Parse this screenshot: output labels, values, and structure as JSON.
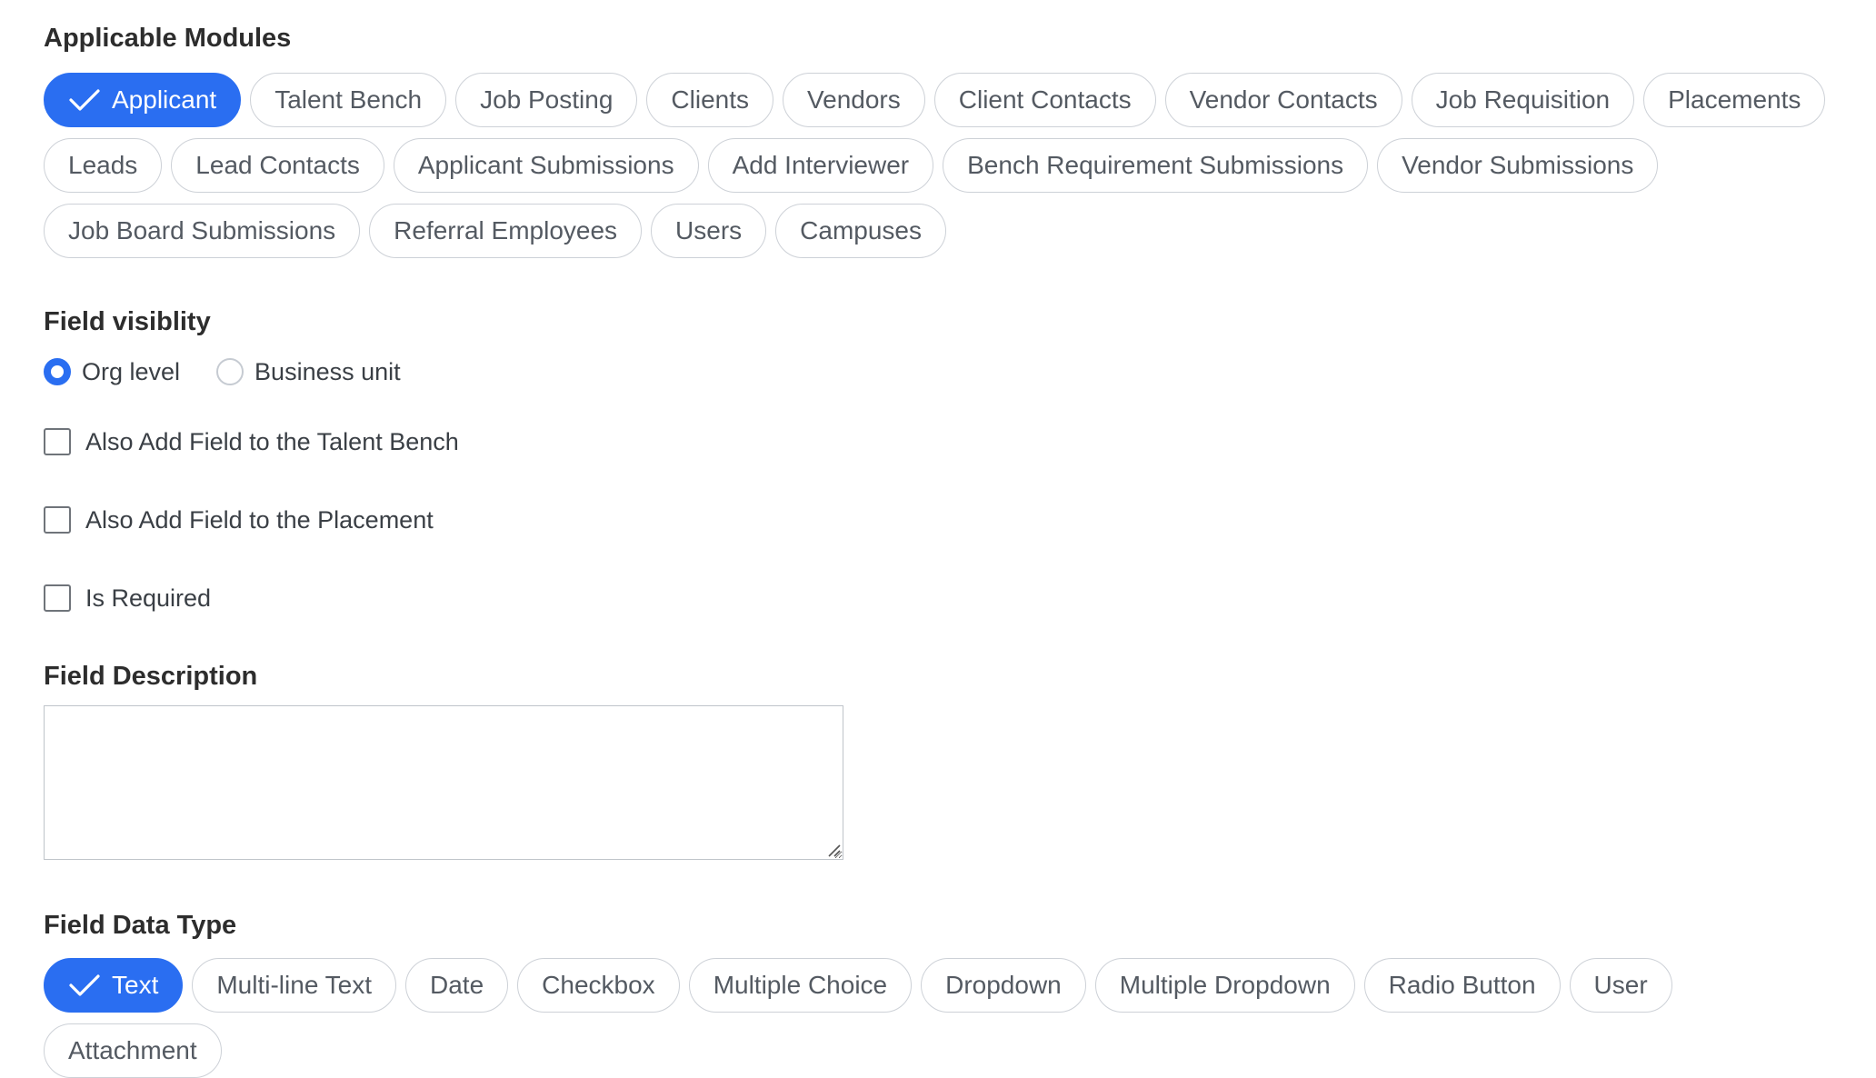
{
  "modules": {
    "title": "Applicable Modules",
    "items": [
      {
        "label": "Applicant",
        "selected": true
      },
      {
        "label": "Talent Bench",
        "selected": false
      },
      {
        "label": "Job Posting",
        "selected": false
      },
      {
        "label": "Clients",
        "selected": false
      },
      {
        "label": "Vendors",
        "selected": false
      },
      {
        "label": "Client Contacts",
        "selected": false
      },
      {
        "label": "Vendor Contacts",
        "selected": false
      },
      {
        "label": "Job Requisition",
        "selected": false
      },
      {
        "label": "Placements",
        "selected": false
      },
      {
        "label": "Leads",
        "selected": false
      },
      {
        "label": "Lead Contacts",
        "selected": false
      },
      {
        "label": "Applicant Submissions",
        "selected": false
      },
      {
        "label": "Add Interviewer",
        "selected": false
      },
      {
        "label": "Bench Requirement Submissions",
        "selected": false
      },
      {
        "label": "Vendor Submissions",
        "selected": false
      },
      {
        "label": "Job Board Submissions",
        "selected": false
      },
      {
        "label": "Referral Employees",
        "selected": false
      },
      {
        "label": "Users",
        "selected": false
      },
      {
        "label": "Campuses",
        "selected": false
      }
    ]
  },
  "visibility": {
    "title": "Field visiblity",
    "options": [
      {
        "label": "Org level",
        "selected": true
      },
      {
        "label": "Business unit",
        "selected": false
      }
    ]
  },
  "checkboxes": [
    {
      "label": "Also Add Field to the Talent Bench",
      "checked": false
    },
    {
      "label": "Also Add Field to the Placement",
      "checked": false
    },
    {
      "label": "Is Required",
      "checked": false
    }
  ],
  "description": {
    "title": "Field Description",
    "value": ""
  },
  "data_type": {
    "title": "Field Data Type",
    "items": [
      {
        "label": "Text",
        "selected": true
      },
      {
        "label": "Multi-line Text",
        "selected": false
      },
      {
        "label": "Date",
        "selected": false
      },
      {
        "label": "Checkbox",
        "selected": false
      },
      {
        "label": "Multiple Choice",
        "selected": false
      },
      {
        "label": "Dropdown",
        "selected": false
      },
      {
        "label": "Multiple Dropdown",
        "selected": false
      },
      {
        "label": "Radio Button",
        "selected": false
      },
      {
        "label": "User",
        "selected": false
      },
      {
        "label": "Attachment",
        "selected": false
      }
    ]
  },
  "colors": {
    "accent": "#2a6ef1",
    "chip_border": "#cdd1d7",
    "text": "#2d2d2d"
  },
  "icons": {
    "selected_chip": "checkmark-icon",
    "textarea_grip": "resize-grip-icon"
  }
}
